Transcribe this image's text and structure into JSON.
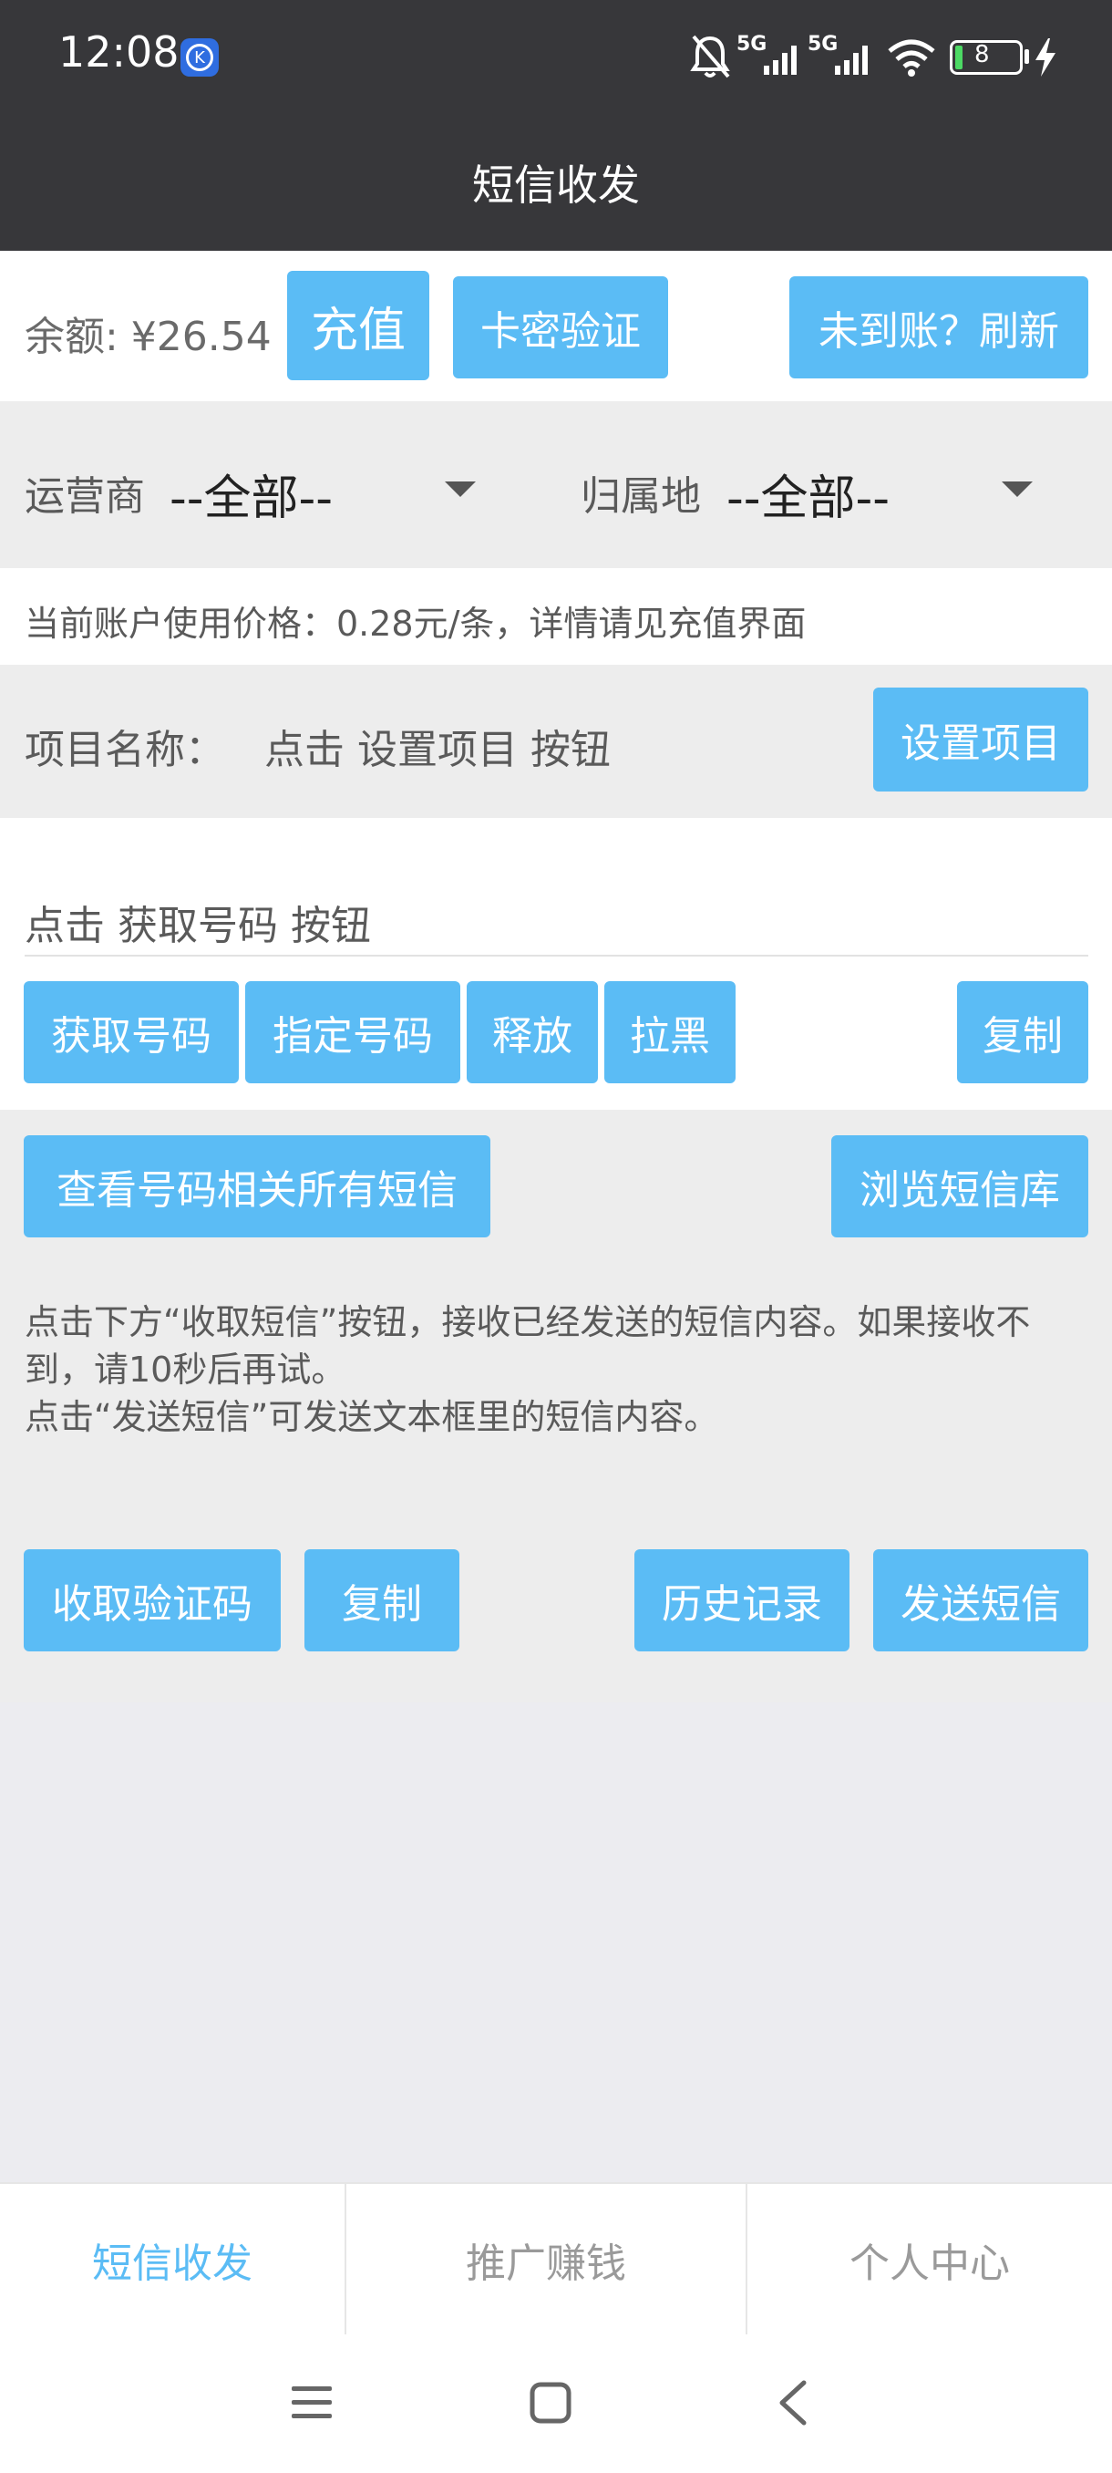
{
  "status_bar": {
    "time": "12:08",
    "app_badge": "K",
    "net1": "5G",
    "net2": "5G",
    "battery": "8"
  },
  "header": {
    "title": "短信收发"
  },
  "account": {
    "balance_label": "余额: ¥26.54",
    "recharge_btn": "充值",
    "card_verify_btn": "卡密验证",
    "refresh_btn": "未到账？刷新"
  },
  "filters": {
    "carrier_label": "运营商",
    "carrier_value": "--全部--",
    "region_label": "归属地",
    "region_value": "--全部--"
  },
  "price_notice": "当前账户使用价格：0.28元/条，详情请见充值界面",
  "project": {
    "label": "项目名称：",
    "value": "点击 设置项目 按钮",
    "set_btn": "设置项目"
  },
  "number": {
    "display": "点击 获取号码 按钮",
    "get_btn": "获取号码",
    "assign_btn": "指定号码",
    "release_btn": "释放",
    "block_btn": "拉黑",
    "copy_btn": "复制"
  },
  "sms": {
    "view_all_btn": "查看号码相关所有短信",
    "browse_lib_btn": "浏览短信库",
    "instruction_line1": "点击下方“收取短信”按钮，接收已经发送的短信内容。如果接收不",
    "instruction_line2": "到，请10秒后再试。",
    "instruction_line3": "点击“发送短信”可发送文本框里的短信内容。",
    "receive_btn": "收取验证码",
    "copy_btn": "复制",
    "history_btn": "历史记录",
    "send_btn": "发送短信"
  },
  "tabs": {
    "sms": "短信收发",
    "promote": "推广赚钱",
    "profile": "个人中心"
  },
  "colors": {
    "accent": "#5bbcf5",
    "header_bg": "#37373a",
    "active_tab": "#5bbcf5"
  }
}
